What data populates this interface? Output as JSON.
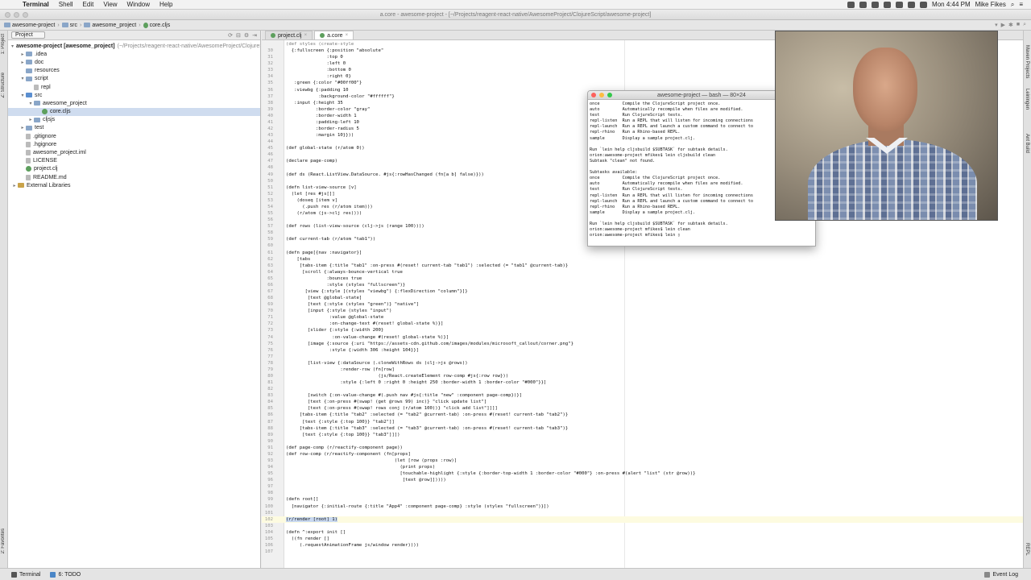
{
  "menubar": {
    "apple": "",
    "items": [
      "Terminal",
      "Shell",
      "Edit",
      "View",
      "Window",
      "Help"
    ],
    "clock": "Mon 4:44 PM",
    "user": "Mike Fikes"
  },
  "window": {
    "title": "a.core - awesome-project - [~/Projects/reagent-react-native/AwesomeProject/ClojureScript/awesome-project]"
  },
  "nav": {
    "crumbs": [
      "awesome-project",
      "src",
      "awesome_project",
      "core.cljs"
    ]
  },
  "sidestrip": {
    "left": [
      "1: Project",
      "Z: Structure",
      "2: Favorites"
    ],
    "right": [
      "Maven Projects",
      "Leiningen",
      "Ant Build",
      "REPL"
    ]
  },
  "project": {
    "selector": "Project",
    "tree": [
      {
        "indent": 0,
        "arrow": "▾",
        "icon": "folder",
        "name": "awesome-project [awesome_project]",
        "path": "(~/Projects/reagent-react-native/AwesomeProject/ClojureScript",
        "bold": true
      },
      {
        "indent": 1,
        "arrow": "▸",
        "icon": "folder",
        "name": ".idea",
        "path": ""
      },
      {
        "indent": 1,
        "arrow": "▸",
        "icon": "folder",
        "name": "doc",
        "path": ""
      },
      {
        "indent": 1,
        "arrow": "",
        "icon": "folder",
        "name": "resources",
        "path": ""
      },
      {
        "indent": 1,
        "arrow": "▾",
        "icon": "folder",
        "name": "script",
        "path": ""
      },
      {
        "indent": 2,
        "arrow": "",
        "icon": "file",
        "name": "repl",
        "path": ""
      },
      {
        "indent": 1,
        "arrow": "▾",
        "icon": "src",
        "name": "src",
        "path": ""
      },
      {
        "indent": 2,
        "arrow": "▾",
        "icon": "folder",
        "name": "awesome_project",
        "path": ""
      },
      {
        "indent": 3,
        "arrow": "",
        "icon": "cljs",
        "name": "core.cljs",
        "path": "",
        "selected": true
      },
      {
        "indent": 2,
        "arrow": "▸",
        "icon": "folder",
        "name": "cljsjs",
        "path": ""
      },
      {
        "indent": 1,
        "arrow": "▸",
        "icon": "folder",
        "name": "test",
        "path": ""
      },
      {
        "indent": 1,
        "arrow": "",
        "icon": "file",
        "name": ".gitignore",
        "path": ""
      },
      {
        "indent": 1,
        "arrow": "",
        "icon": "file",
        "name": ".hgignore",
        "path": ""
      },
      {
        "indent": 1,
        "arrow": "",
        "icon": "file",
        "name": "awesome_project.iml",
        "path": ""
      },
      {
        "indent": 1,
        "arrow": "",
        "icon": "file",
        "name": "LICENSE",
        "path": ""
      },
      {
        "indent": 1,
        "arrow": "",
        "icon": "cljs",
        "name": "project.clj",
        "path": ""
      },
      {
        "indent": 1,
        "arrow": "",
        "icon": "file",
        "name": "README.md",
        "path": ""
      },
      {
        "indent": 0,
        "arrow": "▸",
        "icon": "lib",
        "name": "External Libraries",
        "path": ""
      }
    ]
  },
  "editor": {
    "tabs": [
      {
        "label": "project.clj",
        "active": false
      },
      {
        "label": "a.core",
        "active": true
      }
    ],
    "lines": [
      {
        "n": "",
        "t": "(def styles (create-style"
      },
      {
        "n": "30",
        "t": "  {:fullscreen {:position \"absolute\""
      },
      {
        "n": "31",
        "t": "               :top 0"
      },
      {
        "n": "32",
        "t": "               :left 0"
      },
      {
        "n": "33",
        "t": "               :bottom 0"
      },
      {
        "n": "34",
        "t": "               :right 0}"
      },
      {
        "n": "35",
        "t": "   :green {:color \"#00ff00\"}"
      },
      {
        "n": "36",
        "t": "   :viewbg {:padding 10"
      },
      {
        "n": "37",
        "t": "            :background-color \"#ffffff\"}"
      },
      {
        "n": "38",
        "t": "   :input {:height 35"
      },
      {
        "n": "39",
        "t": "           :border-color \"gray\""
      },
      {
        "n": "40",
        "t": "           :border-width 1"
      },
      {
        "n": "41",
        "t": "           :padding-left 10"
      },
      {
        "n": "42",
        "t": "           :border-radius 5"
      },
      {
        "n": "43",
        "t": "           :margin 10}}))"
      },
      {
        "n": "44",
        "t": ""
      },
      {
        "n": "45",
        "t": "(def global-state (r/atom 0))"
      },
      {
        "n": "46",
        "t": ""
      },
      {
        "n": "47",
        "t": "(declare page-comp)"
      },
      {
        "n": "48",
        "t": ""
      },
      {
        "n": "49",
        "t": "(def ds (React.ListView.DataSource. #js{:rowHasChanged (fn[a b] false)}))"
      },
      {
        "n": "50",
        "t": ""
      },
      {
        "n": "51",
        "t": "(defn list-view-source [v]"
      },
      {
        "n": "52",
        "t": "  (let [res #js[]]"
      },
      {
        "n": "53",
        "t": "    (doseq [item v]"
      },
      {
        "n": "54",
        "t": "      (.push res (r/atom item)))"
      },
      {
        "n": "55",
        "t": "    (r/atom (js->clj res))))"
      },
      {
        "n": "56",
        "t": ""
      },
      {
        "n": "57",
        "t": "(def rows (list-view-source (clj->js (range 100))))"
      },
      {
        "n": "58",
        "t": ""
      },
      {
        "n": "59",
        "t": "(def current-tab (r/atom \"tab1\"))"
      },
      {
        "n": "60",
        "t": ""
      },
      {
        "n": "61",
        "t": "(defn page[{nav :navigator}]"
      },
      {
        "n": "62",
        "t": "    [tabs"
      },
      {
        "n": "63",
        "t": "     [tabs-item {:title \"tab1\" :on-press #(reset! current-tab \"tab1\") :selected (= \"tab1\" @current-tab)}"
      },
      {
        "n": "64",
        "t": "      [scroll {:always-bounce-vertical true"
      },
      {
        "n": "65",
        "t": "               :bounces true"
      },
      {
        "n": "66",
        "t": "               :style (styles \"fullscreen\")}"
      },
      {
        "n": "67",
        "t": "       [view {:style [(styles \"viewbg\") {:flexDirection \"column\"}]}"
      },
      {
        "n": "68",
        "t": "        [text @global-state]"
      },
      {
        "n": "69",
        "t": "        [text {:style (styles \"green\")} \"native\"]"
      },
      {
        "n": "70",
        "t": "        [input {:style (styles \"input\")"
      },
      {
        "n": "71",
        "t": "                :value @global-state"
      },
      {
        "n": "72",
        "t": "                :on-change-text #(reset! global-state %)}]"
      },
      {
        "n": "73",
        "t": "        [slider {:style {:width 200}"
      },
      {
        "n": "74",
        "t": "                 :on-value-change #(reset! global-state %)}]"
      },
      {
        "n": "75",
        "t": "        [image {:source {:uri \"https://assets-cdn.github.com/images/modules/microsoft_callout/corner.png\"}"
      },
      {
        "n": "76",
        "t": "                :style {:width 306 :height 104}}]"
      },
      {
        "n": "77",
        "t": ""
      },
      {
        "n": "78",
        "t": "        [list-view {:dataSource (.cloneWithRows ds (clj->js @rows))"
      },
      {
        "n": "79",
        "t": "                    :render-row (fn[row]"
      },
      {
        "n": "80",
        "t": "                                  (js/React.createElement row-comp #js{:row row}))"
      },
      {
        "n": "81",
        "t": "                    :style {:left 0 :right 0 :height 250 :border-width 1 :border-color \"#000\"}}]"
      },
      {
        "n": "82",
        "t": ""
      },
      {
        "n": "83",
        "t": "        [switch {:on-value-change #(.push nav #js{:title \"new\" :component page-comp})}]"
      },
      {
        "n": "84",
        "t": "        [text {:on-press #(swap! (get @rows 99) inc)} \"click update list\"]"
      },
      {
        "n": "85",
        "t": "        [text {:on-press #(swap! rows conj (r/atom 100))} \"click add list\"]]]]"
      },
      {
        "n": "86",
        "t": "     [tabs-item {:title \"tab2\" :selected (= \"tab2\" @current-tab) :on-press #(reset! current-tab \"tab2\")}"
      },
      {
        "n": "87",
        "t": "      [text {:style {:top 100}} \"tab2\"]]"
      },
      {
        "n": "88",
        "t": "     [tabs-item {:title \"tab3\" :selected (= \"tab3\" @current-tab) :on-press #(reset! current-tab \"tab3\")}"
      },
      {
        "n": "89",
        "t": "      [text {:style {:top 100}} \"tab3\"]]])"
      },
      {
        "n": "90",
        "t": ""
      },
      {
        "n": "91",
        "t": "(def page-comp (r/reactify-component page))"
      },
      {
        "n": "92",
        "t": "(def row-comp (r/reactify-component (fn[props]"
      },
      {
        "n": "93",
        "t": "                                        (let [row (props :row)]"
      },
      {
        "n": "94",
        "t": "                                          (print props)"
      },
      {
        "n": "95",
        "t": "                                          [touchable-highlight {:style {:border-top-width 1 :border-color \"#000\"} :on-press #(alert \"list\" (str @row))}"
      },
      {
        "n": "96",
        "t": "                                           [text @row]]))))"
      },
      {
        "n": "97",
        "t": ""
      },
      {
        "n": "98",
        "t": ""
      },
      {
        "n": "99",
        "t": "(defn root[]"
      },
      {
        "n": "100",
        "t": "  [navigator {:initial-route {:title \"App4\" :component page-comp} :style (styles \"fullscreen\")}])"
      },
      {
        "n": "101",
        "t": ""
      },
      {
        "n": "102",
        "t": "(r/render [root] 1)",
        "hl": true
      },
      {
        "n": "103",
        "t": ""
      },
      {
        "n": "104",
        "t": "(defn ^:export init []"
      },
      {
        "n": "105",
        "t": "  ((fn render []"
      },
      {
        "n": "106",
        "t": "     (.requestAnimationFrame js/window render))))"
      },
      {
        "n": "107",
        "t": ""
      }
    ]
  },
  "terminal": {
    "title": "awesome-project — bash — 80×24",
    "lines": [
      "once         Compile the ClojureScript project once.",
      "auto         Automatically recompile when files are modified.",
      "test         Run ClojureScript tests.",
      "repl-listen  Run a REPL that will listen for incoming connections",
      "repl-launch  Run a REPL and launch a custom command to connect to",
      "repl-rhino   Run a Rhino-based REPL.",
      "sample       Display a sample project.clj.",
      "",
      "Run `lein help cljsbuild $SUBTASK` for subtask details.",
      "orion:awesome-project mfikes$ lein cljsbuild clean",
      "Subtask \"clean\" not found.",
      "",
      "Subtasks available:",
      "once         Compile the ClojureScript project once.",
      "auto         Automatically recompile when files are modified.",
      "test         Run ClojureScript tests.",
      "repl-listen  Run a REPL that will listen for incoming connections",
      "repl-launch  Run a REPL and launch a custom command to connect to",
      "repl-rhino   Run a Rhino-based REPL.",
      "sample       Display a sample project.clj.",
      "",
      "Run `lein help cljsbuild $SUBTASK` for subtask details.",
      "orion:awesome-project mfikes$ lein clean",
      "orion:awesome-project mfikes$ lein ▯"
    ]
  },
  "statusbar": {
    "terminal": "Terminal",
    "todo": "6: TODO",
    "eventlog": "Event Log"
  }
}
